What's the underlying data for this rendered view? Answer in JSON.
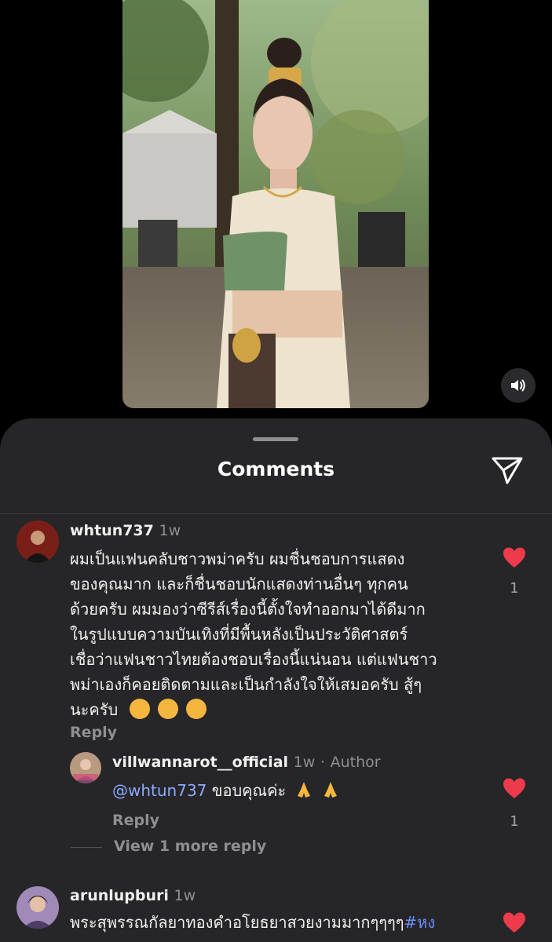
{
  "sheet": {
    "title": "Comments"
  },
  "comments": [
    {
      "username": "whtun737",
      "time": "1w",
      "lines": [
        "ผมเป็นแฟนคลับชาวพม่าครับ ผมชื่นชอบการแสดง",
        "ของคุณมาก และก็ชื่นชอบนักแสดงท่านอื่นๆ ทุกคน",
        "ด้วยครับ ผมมองว่าซีรีส์เรื่องนี้ตั้งใจทำออกมาได้ดีมาก",
        "ในรูปแบบความบันเทิงที่มีพื้นหลังเป็นประวัติศาสตร์",
        "เชื่อว่าแฟนชาวไทยต้องชอบเรื่องนี้แน่นอน แต่แฟนชาว",
        "พม่าเองก็คอยติดตามและเป็นกำลังใจให้เสมอครับ สู้ๆ"
      ],
      "last_line": "นะครับ",
      "reply_label": "Reply",
      "like_count": "1",
      "reply": {
        "username": "villwannarot__official",
        "time": "1w",
        "author_badge": "Author",
        "mention": "@whtun737",
        "text": "ขอบคุณค่ะ",
        "reply_label": "Reply",
        "like_count": "1"
      },
      "view_more": "View 1 more reply"
    },
    {
      "username": "arunlupburi",
      "time": "1w",
      "text": "พระสุพรรณกัลยาทองคำอโยธยาสวยงามมากๆๆๆๆ",
      "hashtag": "#หง"
    }
  ],
  "colors": {
    "like_red": "#ee3b4b",
    "mention_blue": "#8ea9ff",
    "sheet_bg": "#262628"
  },
  "icons": [
    "speaker-icon",
    "send-icon",
    "heart-icon"
  ]
}
